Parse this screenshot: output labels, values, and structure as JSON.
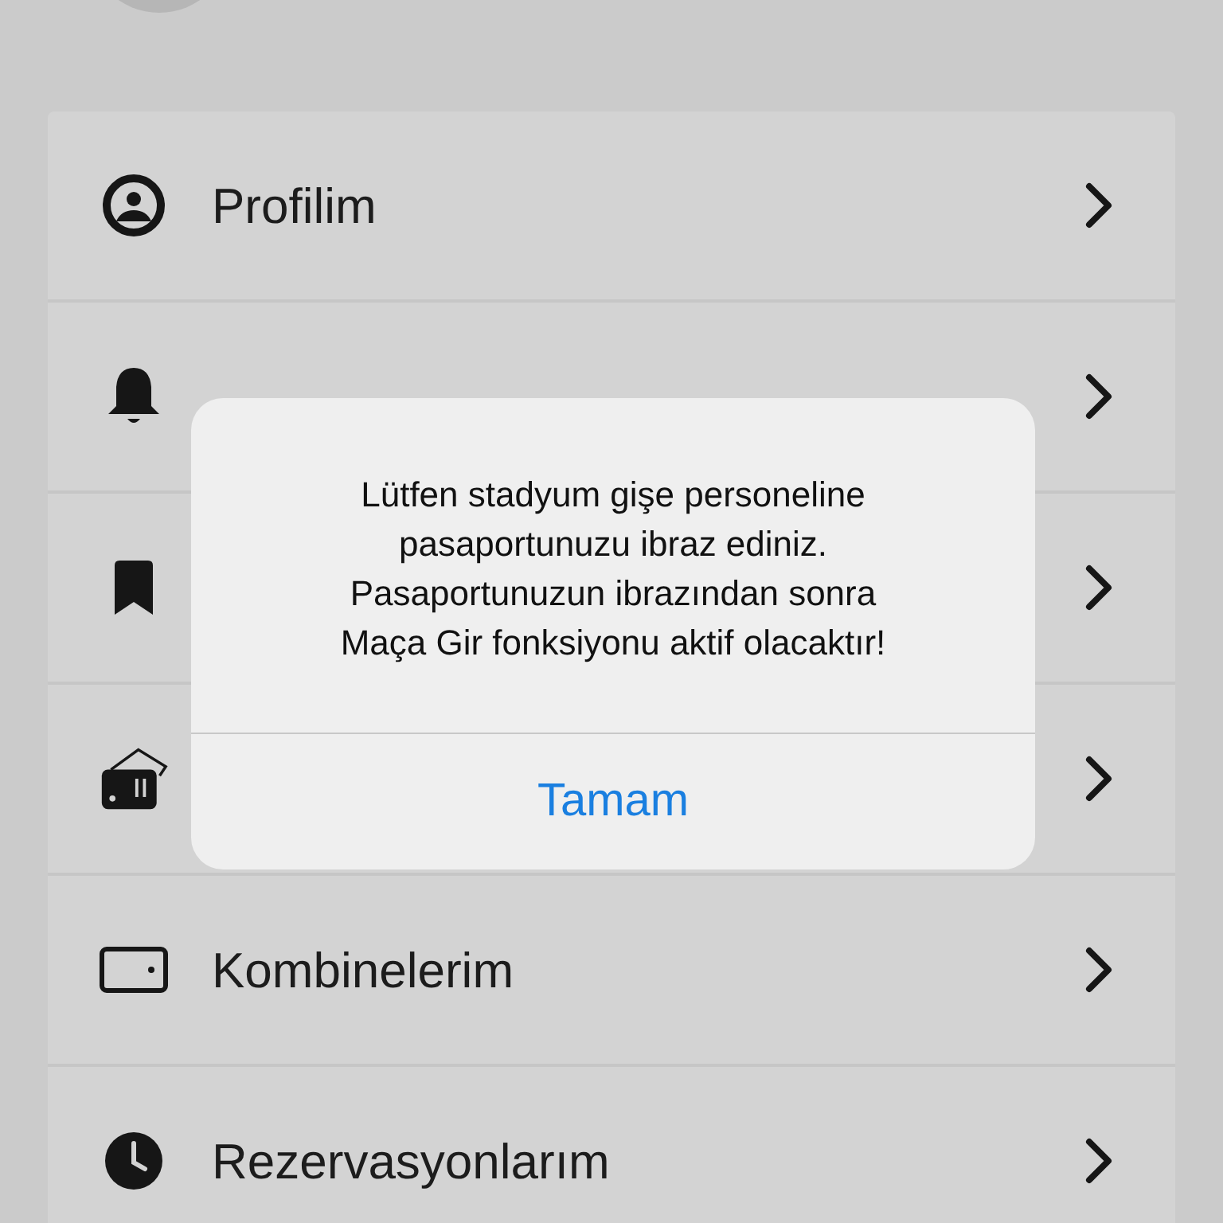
{
  "menu": {
    "items": [
      {
        "label": "Profilim",
        "chevron": true
      },
      {
        "chevron": true
      },
      {
        "chevron": true
      },
      {
        "chevron": true
      },
      {
        "label": "Kombinelerim",
        "chevron": true
      },
      {
        "label": "Rezervasyonlarım",
        "chevron": true
      }
    ]
  },
  "alert": {
    "message": [
      "Lütfen stadyum gişe personeline",
      "pasaportunuzu ibraz ediniz.",
      "Pasaportunuzun ibrazından sonra",
      "Maça Gir fonksiyonu aktif olacaktır!"
    ],
    "button": "Tamam"
  }
}
